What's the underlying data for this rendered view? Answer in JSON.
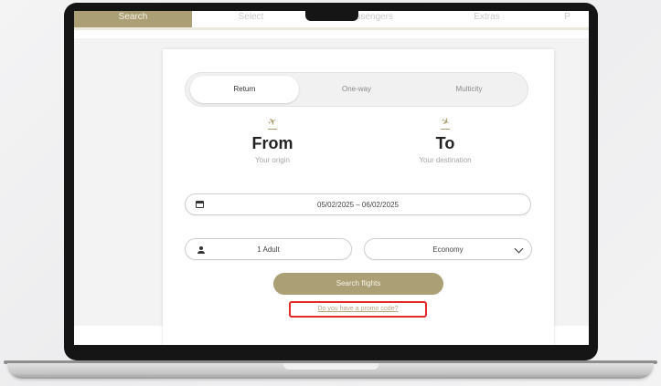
{
  "steps": [
    "Search",
    "Select",
    "Passengers",
    "Extras",
    "P"
  ],
  "trip_types": [
    "Return",
    "One-way",
    "Multicity"
  ],
  "origin": {
    "title": "From",
    "subtitle": "Your origin"
  },
  "destination": {
    "title": "To",
    "subtitle": "Your destination"
  },
  "dates": {
    "value": "05/02/2025  –  06/02/2025"
  },
  "passengers": {
    "value": "1 Adult"
  },
  "cabin_class": {
    "value": "Economy"
  },
  "search_button": {
    "label": "Search flights"
  },
  "promo_link": {
    "label": "Do you have a promo code?"
  },
  "icons": {
    "departure": "✈",
    "arrival": "✈",
    "calendar": "calendar-icon",
    "passenger": "person-icon",
    "dropdown": "chevron-down-icon"
  },
  "colors": {
    "accent": "#ab9f75",
    "highlight": "#e32a2a"
  }
}
